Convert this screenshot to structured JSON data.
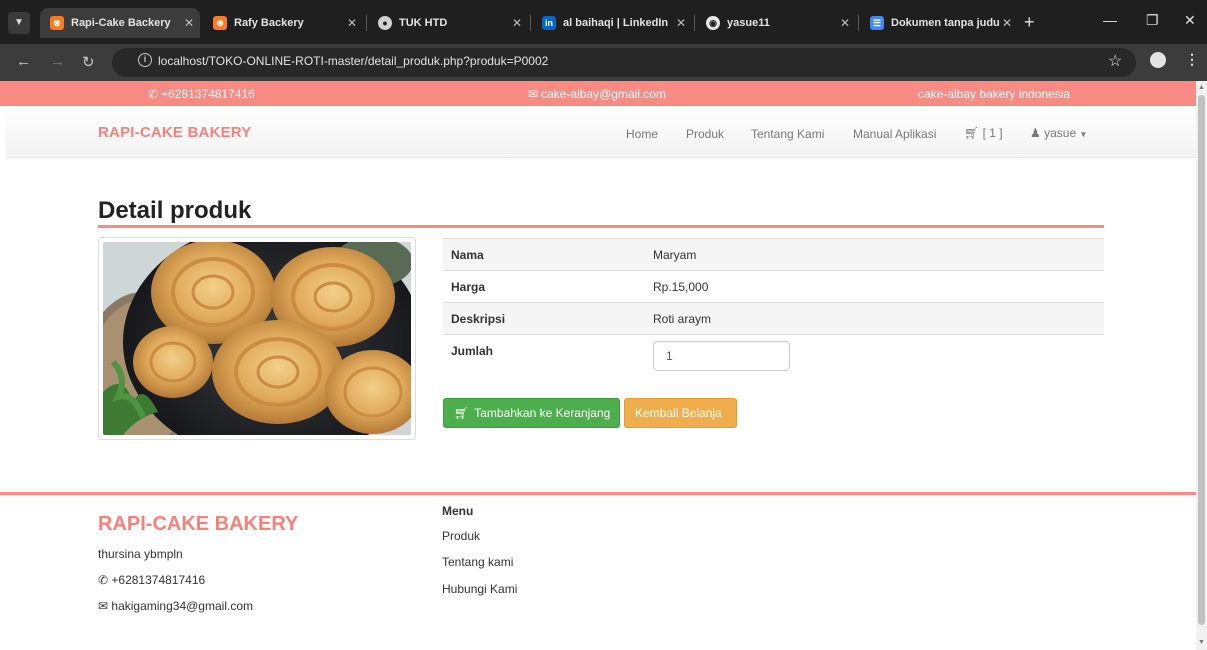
{
  "browser": {
    "tabs": [
      {
        "title": "Rapi-Cake Backery",
        "icon": "xampp-icon",
        "active": true
      },
      {
        "title": "Rafy Backery",
        "icon": "xampp-icon"
      },
      {
        "title": "TUK HTD",
        "icon": "globe-icon"
      },
      {
        "title": "al baihaqi | LinkedIn",
        "icon": "linkedin-icon"
      },
      {
        "title": "yasue11",
        "icon": "github-icon"
      },
      {
        "title": "Dokumen tanpa judu",
        "icon": "docs-icon"
      }
    ],
    "url": "localhost/TOKO-ONLINE-ROTI-master/detail_produk.php?produk=P0002"
  },
  "topbar": {
    "phone": "+6281374817416",
    "email": "cake-albay@gmail.com",
    "tagline": "cake-albay bakery indonesia",
    "color": "#f88b84"
  },
  "navbar": {
    "brand": "RAPI-CAKE BAKERY",
    "links": [
      "Home",
      "Produk",
      "Tentang Kami",
      "Manual Aplikasi"
    ],
    "cart_count": "[ 1 ]",
    "user": "yasue"
  },
  "main": {
    "title": "Detail produk",
    "product_image_alt": "roti maryam",
    "rows": [
      {
        "label": "Nama",
        "value": "Maryam"
      },
      {
        "label": "Harga",
        "value": "Rp.15,000"
      },
      {
        "label": "Deskripsi",
        "value": "Roti araym"
      },
      {
        "label": "Jumlah",
        "value": "1"
      }
    ],
    "add_to_cart_label": "Tambahkan ke Keranjang",
    "back_label": "Kembali Belanja"
  },
  "footer": {
    "brand": "RAPI-CAKE BAKERY",
    "address": "thursina ybmpln",
    "phone": "+6281374817416",
    "email": "hakigaming34@gmail.com",
    "menu_title": "Menu",
    "menu_links": [
      "Produk",
      "Tentang kami",
      "Hubungi Kami"
    ]
  }
}
